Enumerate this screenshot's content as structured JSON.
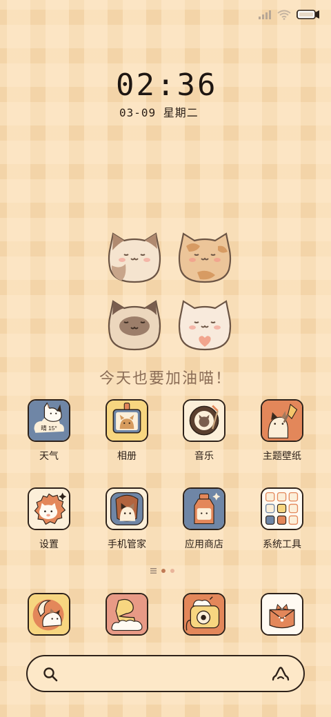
{
  "status": {
    "icons": [
      "signal-icon",
      "wifi-icon",
      "battery-icon"
    ]
  },
  "clock": {
    "time": "02:36",
    "date": "03-09  星期二"
  },
  "widget": {
    "motto": "今天也要加油喵！"
  },
  "apps": [
    {
      "label": "天气",
      "icon": "weather-icon",
      "badge": "晴 15°"
    },
    {
      "label": "相册",
      "icon": "album-icon"
    },
    {
      "label": "音乐",
      "icon": "music-icon"
    },
    {
      "label": "主题壁纸",
      "icon": "theme-icon"
    },
    {
      "label": "设置",
      "icon": "settings-icon"
    },
    {
      "label": "手机管家",
      "icon": "security-icon"
    },
    {
      "label": "应用商店",
      "icon": "store-icon"
    },
    {
      "label": "系统工具",
      "icon": "tools-icon"
    }
  ],
  "pager": {
    "pages": 3,
    "current": 2
  },
  "dock": [
    {
      "icon": "phone-icon"
    },
    {
      "icon": "messages-icon"
    },
    {
      "icon": "camera-icon"
    },
    {
      "icon": "browser-icon"
    }
  ],
  "search": {
    "left_icon": "search-icon",
    "right_icon": "assistant-icon"
  },
  "colors": {
    "outline": "#2d2119",
    "background": "#f3d4a8",
    "blue": "#6f86a6",
    "orange": "#e3875a",
    "cream": "#fcefd9"
  }
}
